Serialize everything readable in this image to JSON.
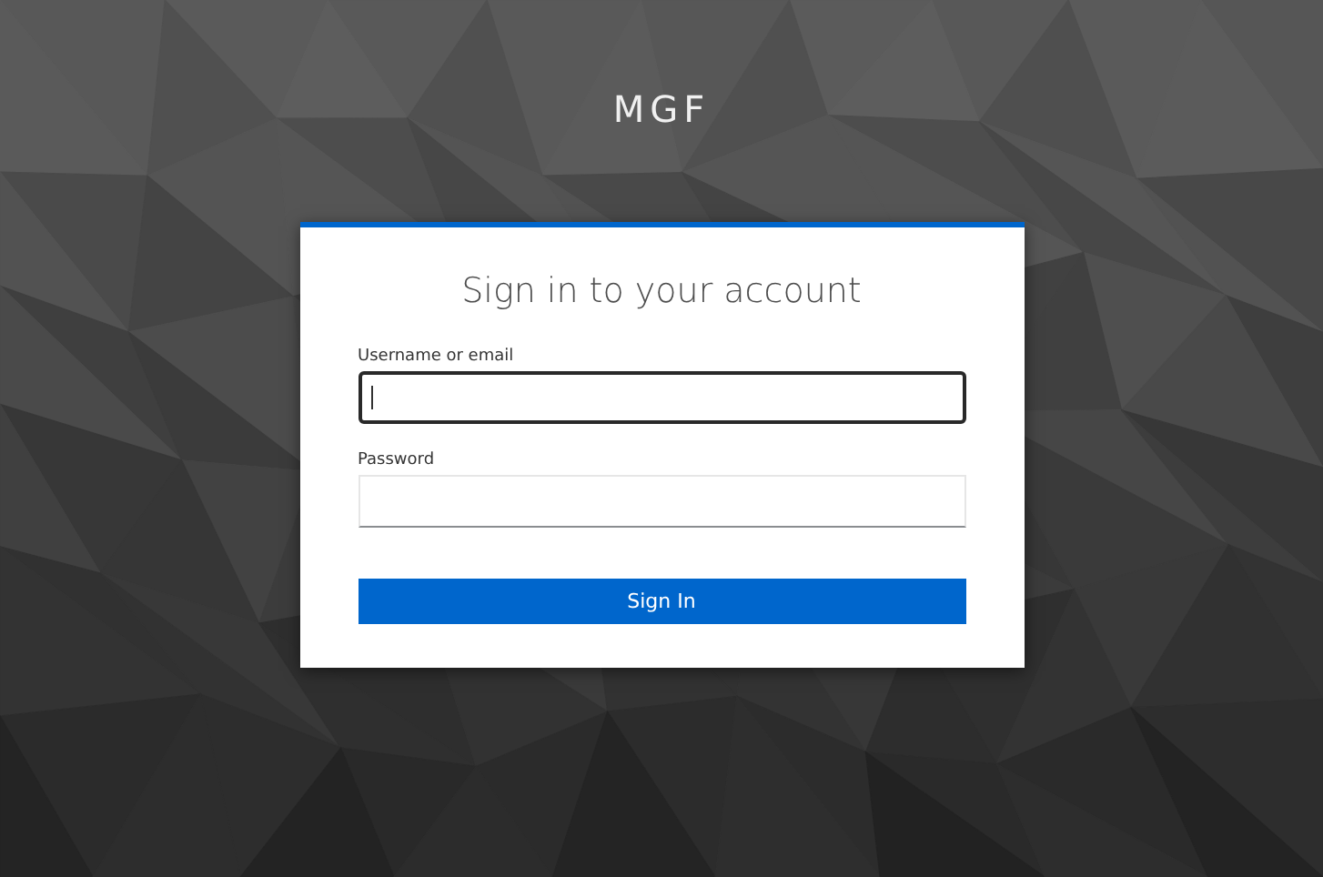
{
  "brand": "MGF",
  "card": {
    "title": "Sign in to your account",
    "fields": [
      {
        "label": "Username or email",
        "focused": true
      },
      {
        "label": "Password",
        "focused": false
      }
    ],
    "submit": "Sign In"
  }
}
